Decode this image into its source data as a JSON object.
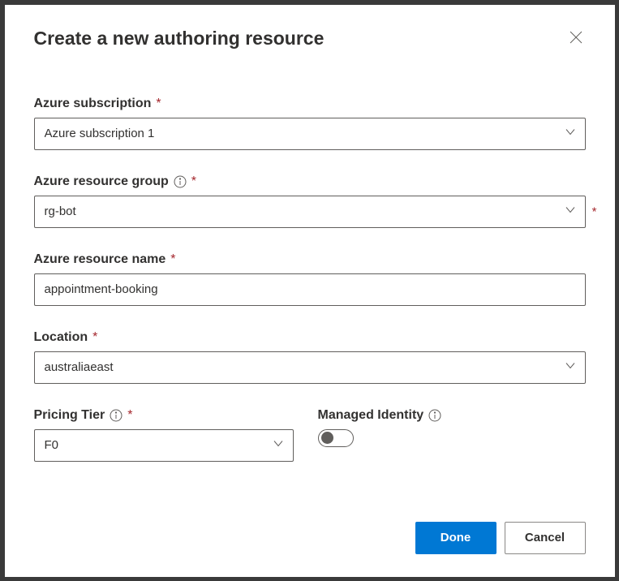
{
  "dialog": {
    "title": "Create a new authoring resource"
  },
  "fields": {
    "subscription": {
      "label": "Azure subscription",
      "value": "Azure subscription 1"
    },
    "resourceGroup": {
      "label": "Azure resource group",
      "value": "rg-bot"
    },
    "resourceName": {
      "label": "Azure resource name",
      "value": "appointment-booking"
    },
    "location": {
      "label": "Location",
      "value": "australiaeast"
    },
    "pricingTier": {
      "label": "Pricing Tier",
      "value": "F0"
    },
    "managedIdentity": {
      "label": "Managed Identity"
    }
  },
  "buttons": {
    "done": "Done",
    "cancel": "Cancel"
  }
}
